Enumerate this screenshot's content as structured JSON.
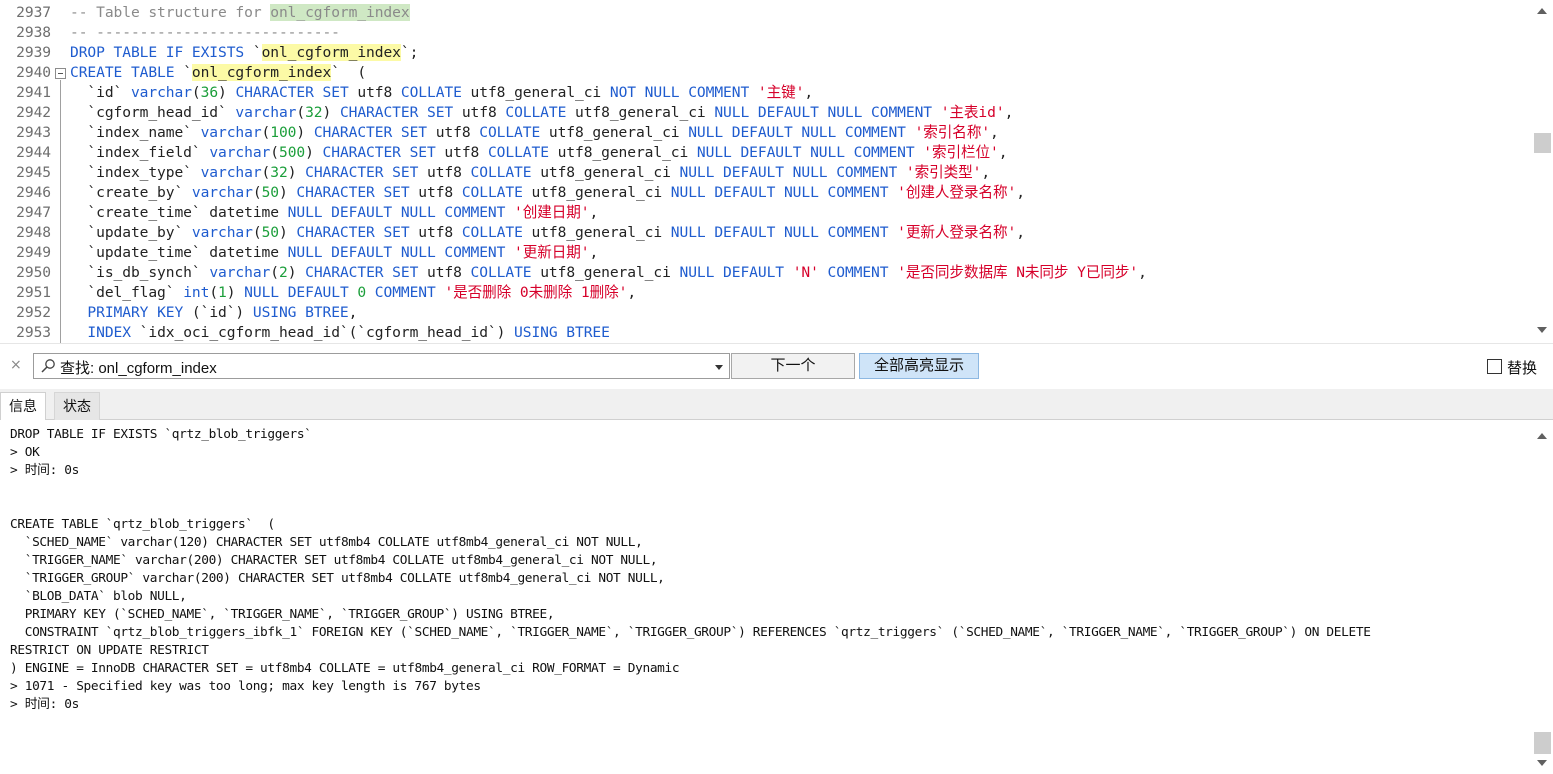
{
  "editor": {
    "lines": [
      {
        "num": "2937",
        "tokens": [
          {
            "t": "-- Table structure for ",
            "c": "c"
          },
          {
            "t": "onl_cgform_index",
            "c": "ch"
          }
        ]
      },
      {
        "num": "2938",
        "tokens": [
          {
            "t": "-- ----------------------------",
            "c": "c"
          }
        ]
      },
      {
        "num": "2939",
        "tokens": [
          {
            "t": "DROP TABLE IF EXISTS ",
            "c": "k"
          },
          {
            "t": "`",
            "c": "i"
          },
          {
            "t": "onl_cgform_index",
            "c": "h"
          },
          {
            "t": "`;",
            "c": "i"
          }
        ]
      },
      {
        "num": "2940",
        "fold": true,
        "tokens": [
          {
            "t": "CREATE TABLE ",
            "c": "k"
          },
          {
            "t": "`",
            "c": "i"
          },
          {
            "t": "onl_cgform_index",
            "c": "h"
          },
          {
            "t": "`  (",
            "c": "i"
          }
        ]
      },
      {
        "num": "2941",
        "tokens": [
          {
            "t": "  `id` ",
            "c": "i"
          },
          {
            "t": "varchar",
            "c": "k"
          },
          {
            "t": "(",
            "c": "i"
          },
          {
            "t": "36",
            "c": "n"
          },
          {
            "t": ") ",
            "c": "i"
          },
          {
            "t": "CHARACTER SET ",
            "c": "k"
          },
          {
            "t": "utf8 ",
            "c": "i"
          },
          {
            "t": "COLLATE ",
            "c": "k"
          },
          {
            "t": "utf8_general_ci ",
            "c": "i"
          },
          {
            "t": "NOT NULL COMMENT ",
            "c": "k"
          },
          {
            "t": "'主键'",
            "c": "s"
          },
          {
            "t": ",",
            "c": "i"
          }
        ]
      },
      {
        "num": "2942",
        "tokens": [
          {
            "t": "  `cgform_head_id` ",
            "c": "i"
          },
          {
            "t": "varchar",
            "c": "k"
          },
          {
            "t": "(",
            "c": "i"
          },
          {
            "t": "32",
            "c": "n"
          },
          {
            "t": ") ",
            "c": "i"
          },
          {
            "t": "CHARACTER SET ",
            "c": "k"
          },
          {
            "t": "utf8 ",
            "c": "i"
          },
          {
            "t": "COLLATE ",
            "c": "k"
          },
          {
            "t": "utf8_general_ci ",
            "c": "i"
          },
          {
            "t": "NULL DEFAULT NULL COMMENT ",
            "c": "k"
          },
          {
            "t": "'主表id'",
            "c": "s"
          },
          {
            "t": ",",
            "c": "i"
          }
        ]
      },
      {
        "num": "2943",
        "tokens": [
          {
            "t": "  `index_name` ",
            "c": "i"
          },
          {
            "t": "varchar",
            "c": "k"
          },
          {
            "t": "(",
            "c": "i"
          },
          {
            "t": "100",
            "c": "n"
          },
          {
            "t": ") ",
            "c": "i"
          },
          {
            "t": "CHARACTER SET ",
            "c": "k"
          },
          {
            "t": "utf8 ",
            "c": "i"
          },
          {
            "t": "COLLATE ",
            "c": "k"
          },
          {
            "t": "utf8_general_ci ",
            "c": "i"
          },
          {
            "t": "NULL DEFAULT NULL COMMENT ",
            "c": "k"
          },
          {
            "t": "'索引名称'",
            "c": "s"
          },
          {
            "t": ",",
            "c": "i"
          }
        ]
      },
      {
        "num": "2944",
        "tokens": [
          {
            "t": "  `index_field` ",
            "c": "i"
          },
          {
            "t": "varchar",
            "c": "k"
          },
          {
            "t": "(",
            "c": "i"
          },
          {
            "t": "500",
            "c": "n"
          },
          {
            "t": ") ",
            "c": "i"
          },
          {
            "t": "CHARACTER SET ",
            "c": "k"
          },
          {
            "t": "utf8 ",
            "c": "i"
          },
          {
            "t": "COLLATE ",
            "c": "k"
          },
          {
            "t": "utf8_general_ci ",
            "c": "i"
          },
          {
            "t": "NULL DEFAULT NULL COMMENT ",
            "c": "k"
          },
          {
            "t": "'索引栏位'",
            "c": "s"
          },
          {
            "t": ",",
            "c": "i"
          }
        ]
      },
      {
        "num": "2945",
        "tokens": [
          {
            "t": "  `index_type` ",
            "c": "i"
          },
          {
            "t": "varchar",
            "c": "k"
          },
          {
            "t": "(",
            "c": "i"
          },
          {
            "t": "32",
            "c": "n"
          },
          {
            "t": ") ",
            "c": "i"
          },
          {
            "t": "CHARACTER SET ",
            "c": "k"
          },
          {
            "t": "utf8 ",
            "c": "i"
          },
          {
            "t": "COLLATE ",
            "c": "k"
          },
          {
            "t": "utf8_general_ci ",
            "c": "i"
          },
          {
            "t": "NULL DEFAULT NULL COMMENT ",
            "c": "k"
          },
          {
            "t": "'索引类型'",
            "c": "s"
          },
          {
            "t": ",",
            "c": "i"
          }
        ]
      },
      {
        "num": "2946",
        "tokens": [
          {
            "t": "  `create_by` ",
            "c": "i"
          },
          {
            "t": "varchar",
            "c": "k"
          },
          {
            "t": "(",
            "c": "i"
          },
          {
            "t": "50",
            "c": "n"
          },
          {
            "t": ") ",
            "c": "i"
          },
          {
            "t": "CHARACTER SET ",
            "c": "k"
          },
          {
            "t": "utf8 ",
            "c": "i"
          },
          {
            "t": "COLLATE ",
            "c": "k"
          },
          {
            "t": "utf8_general_ci ",
            "c": "i"
          },
          {
            "t": "NULL DEFAULT NULL COMMENT ",
            "c": "k"
          },
          {
            "t": "'创建人登录名称'",
            "c": "s"
          },
          {
            "t": ",",
            "c": "i"
          }
        ]
      },
      {
        "num": "2947",
        "tokens": [
          {
            "t": "  `create_time` datetime ",
            "c": "i"
          },
          {
            "t": "NULL DEFAULT NULL COMMENT ",
            "c": "k"
          },
          {
            "t": "'创建日期'",
            "c": "s"
          },
          {
            "t": ",",
            "c": "i"
          }
        ]
      },
      {
        "num": "2948",
        "tokens": [
          {
            "t": "  `update_by` ",
            "c": "i"
          },
          {
            "t": "varchar",
            "c": "k"
          },
          {
            "t": "(",
            "c": "i"
          },
          {
            "t": "50",
            "c": "n"
          },
          {
            "t": ") ",
            "c": "i"
          },
          {
            "t": "CHARACTER SET ",
            "c": "k"
          },
          {
            "t": "utf8 ",
            "c": "i"
          },
          {
            "t": "COLLATE ",
            "c": "k"
          },
          {
            "t": "utf8_general_ci ",
            "c": "i"
          },
          {
            "t": "NULL DEFAULT NULL COMMENT ",
            "c": "k"
          },
          {
            "t": "'更新人登录名称'",
            "c": "s"
          },
          {
            "t": ",",
            "c": "i"
          }
        ]
      },
      {
        "num": "2949",
        "tokens": [
          {
            "t": "  `update_time` datetime ",
            "c": "i"
          },
          {
            "t": "NULL DEFAULT NULL COMMENT ",
            "c": "k"
          },
          {
            "t": "'更新日期'",
            "c": "s"
          },
          {
            "t": ",",
            "c": "i"
          }
        ]
      },
      {
        "num": "2950",
        "tokens": [
          {
            "t": "  `is_db_synch` ",
            "c": "i"
          },
          {
            "t": "varchar",
            "c": "k"
          },
          {
            "t": "(",
            "c": "i"
          },
          {
            "t": "2",
            "c": "n"
          },
          {
            "t": ") ",
            "c": "i"
          },
          {
            "t": "CHARACTER SET ",
            "c": "k"
          },
          {
            "t": "utf8 ",
            "c": "i"
          },
          {
            "t": "COLLATE ",
            "c": "k"
          },
          {
            "t": "utf8_general_ci ",
            "c": "i"
          },
          {
            "t": "NULL DEFAULT ",
            "c": "k"
          },
          {
            "t": "'N' ",
            "c": "s"
          },
          {
            "t": "COMMENT ",
            "c": "k"
          },
          {
            "t": "'是否同步数据库 N未同步 Y已同步'",
            "c": "s"
          },
          {
            "t": ",",
            "c": "i"
          }
        ]
      },
      {
        "num": "2951",
        "tokens": [
          {
            "t": "  `del_flag` ",
            "c": "i"
          },
          {
            "t": "int",
            "c": "k"
          },
          {
            "t": "(",
            "c": "i"
          },
          {
            "t": "1",
            "c": "n"
          },
          {
            "t": ") ",
            "c": "i"
          },
          {
            "t": "NULL DEFAULT ",
            "c": "k"
          },
          {
            "t": "0 ",
            "c": "n"
          },
          {
            "t": "COMMENT ",
            "c": "k"
          },
          {
            "t": "'是否删除 0未删除 1删除'",
            "c": "s"
          },
          {
            "t": ",",
            "c": "i"
          }
        ]
      },
      {
        "num": "2952",
        "tokens": [
          {
            "t": "  ",
            "c": "i"
          },
          {
            "t": "PRIMARY KEY ",
            "c": "k"
          },
          {
            "t": "(`id`) ",
            "c": "i"
          },
          {
            "t": "USING BTREE",
            "c": "k"
          },
          {
            "t": ",",
            "c": "i"
          }
        ]
      },
      {
        "num": "2953",
        "tokens": [
          {
            "t": "  ",
            "c": "i"
          },
          {
            "t": "INDEX ",
            "c": "k"
          },
          {
            "t": "`idx_oci_cgform_head_id`(`cgform_head_id`) ",
            "c": "i"
          },
          {
            "t": "USING BTREE",
            "c": "k"
          }
        ]
      }
    ]
  },
  "findbar": {
    "close": "×",
    "search_icon": "search-icon",
    "text": "查找: onl_cgform_index",
    "next_label": "下一个",
    "highlight_all_label": "全部高亮显示",
    "replace_label": "替换",
    "replace_checked": false
  },
  "tabs": {
    "info": "信息",
    "status": "状态"
  },
  "output": {
    "lines": [
      "DROP TABLE IF EXISTS `qrtz_blob_triggers`",
      "> OK",
      "> 时间: 0s",
      "",
      "",
      "CREATE TABLE `qrtz_blob_triggers`  (",
      "  `SCHED_NAME` varchar(120) CHARACTER SET utf8mb4 COLLATE utf8mb4_general_ci NOT NULL,",
      "  `TRIGGER_NAME` varchar(200) CHARACTER SET utf8mb4 COLLATE utf8mb4_general_ci NOT NULL,",
      "  `TRIGGER_GROUP` varchar(200) CHARACTER SET utf8mb4 COLLATE utf8mb4_general_ci NOT NULL,",
      "  `BLOB_DATA` blob NULL,",
      "  PRIMARY KEY (`SCHED_NAME`, `TRIGGER_NAME`, `TRIGGER_GROUP`) USING BTREE,",
      "  CONSTRAINT `qrtz_blob_triggers_ibfk_1` FOREIGN KEY (`SCHED_NAME`, `TRIGGER_NAME`, `TRIGGER_GROUP`) REFERENCES `qrtz_triggers` (`SCHED_NAME`, `TRIGGER_NAME`, `TRIGGER_GROUP`) ON DELETE",
      "RESTRICT ON UPDATE RESTRICT",
      ") ENGINE = InnoDB CHARACTER SET = utf8mb4 COLLATE = utf8mb4_general_ci ROW_FORMAT = Dynamic",
      "> 1071 - Specified key was too long; max key length is 767 bytes",
      "> 时间: 0s"
    ]
  },
  "colors": {
    "keyword": "#1f5ccf",
    "number": "#1b9e3a",
    "string": "#d6002a",
    "comment": "#8a8a8a",
    "search_highlight": "#fcfaa6",
    "current_match": "#cfe8c4"
  }
}
